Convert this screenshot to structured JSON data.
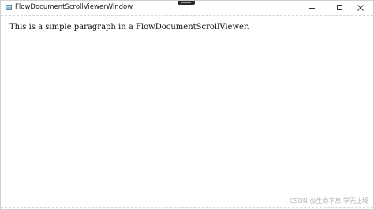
{
  "window": {
    "title": "FlowDocumentScrollViewerWindow",
    "icon": "app-window-icon"
  },
  "caption_buttons": {
    "minimize": "minimize-icon",
    "maximize": "maximize-icon",
    "close": "close-icon"
  },
  "document": {
    "paragraph": "This is a simple paragraph in a FlowDocumentScrollViewer."
  },
  "watermark": {
    "text": "CSDN @生命不息 学无止境"
  }
}
